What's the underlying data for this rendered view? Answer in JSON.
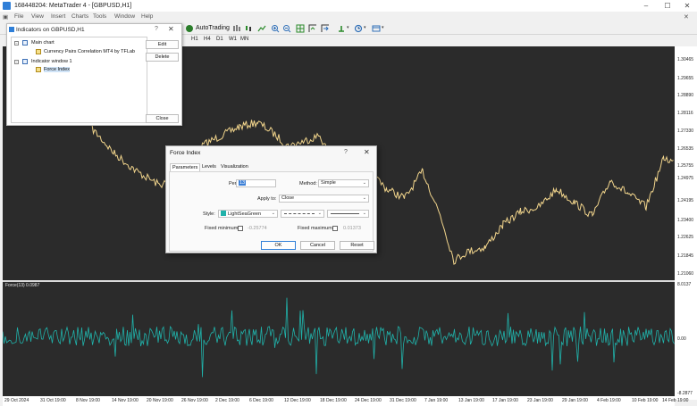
{
  "window": {
    "title": "168448204: MetaTrader 4 - [GBPUSD,H1]"
  },
  "menu": [
    "File",
    "View",
    "Insert",
    "Charts",
    "Tools",
    "Window",
    "Help"
  ],
  "toolbar": {
    "autotrading_label": "AutoTrading"
  },
  "timeframes": [
    "H1",
    "H4",
    "D1",
    "W1",
    "MN"
  ],
  "indicators_window": {
    "title": "Indicators on GBPUSD,H1",
    "main_chart": "Main chart",
    "main_chart_item": "Currency Pairs Correlation MT4 by TFLab",
    "indicator_window": "Indicator window 1",
    "indicator_window_item": "Force Index",
    "edit_label": "Edit",
    "delete_label": "Delete",
    "close_label": "Close"
  },
  "dialog": {
    "title": "Force Index",
    "tabs": [
      "Parameters",
      "Levels",
      "Visualization"
    ],
    "period_label": "Period:",
    "period_value": "13",
    "method_label": "Method:",
    "method_value": "Simple",
    "apply_label": "Apply to:",
    "apply_value": "Close",
    "style_label": "Style:",
    "style_color_name": "LightSeaGreen",
    "fixed_min_label": "Fixed minimum",
    "fixed_min_value": "-0.25774",
    "fixed_max_label": "Fixed maximum",
    "fixed_max_value": "0.01373",
    "ok_label": "OK",
    "cancel_label": "Cancel",
    "reset_label": "Reset"
  },
  "subwindow_label": "Force(13) 0.0987",
  "price_labels": [
    "1.30465",
    "1.29655",
    "1.28890",
    "1.28116",
    "1.27330",
    "1.26535",
    "1.25755",
    "1.24975",
    "1.24195",
    "1.23400",
    "1.22625",
    "1.21845",
    "1.21060"
  ],
  "sub_scale_labels": [
    "8.0137",
    "0.00",
    "-8.2877"
  ],
  "time_labels": [
    "29 Oct 2024",
    "31 Oct 19:00",
    "8 Nov 19:00",
    "14 Nov 19:00",
    "20 Nov 19:00",
    "26 Nov 19:00",
    "2 Dec 19:00",
    "6 Dec 19:00",
    "12 Dec 19:00",
    "18 Dec 19:00",
    "24 Dec 19:00",
    "31 Dec 19:00",
    "7 Jan 19:00",
    "13 Jan 19:00",
    "17 Jan 19:00",
    "23 Jan 19:00",
    "29 Jan 19:00",
    "4 Feb 19:00",
    "10 Feb 19:00",
    "14 Feb 19:00"
  ],
  "colors": {
    "chart_bg": "#2b2b2b",
    "price_line": "#f2d58c",
    "force_line": "#20b2aa",
    "style_swatch": "#20b2aa"
  }
}
